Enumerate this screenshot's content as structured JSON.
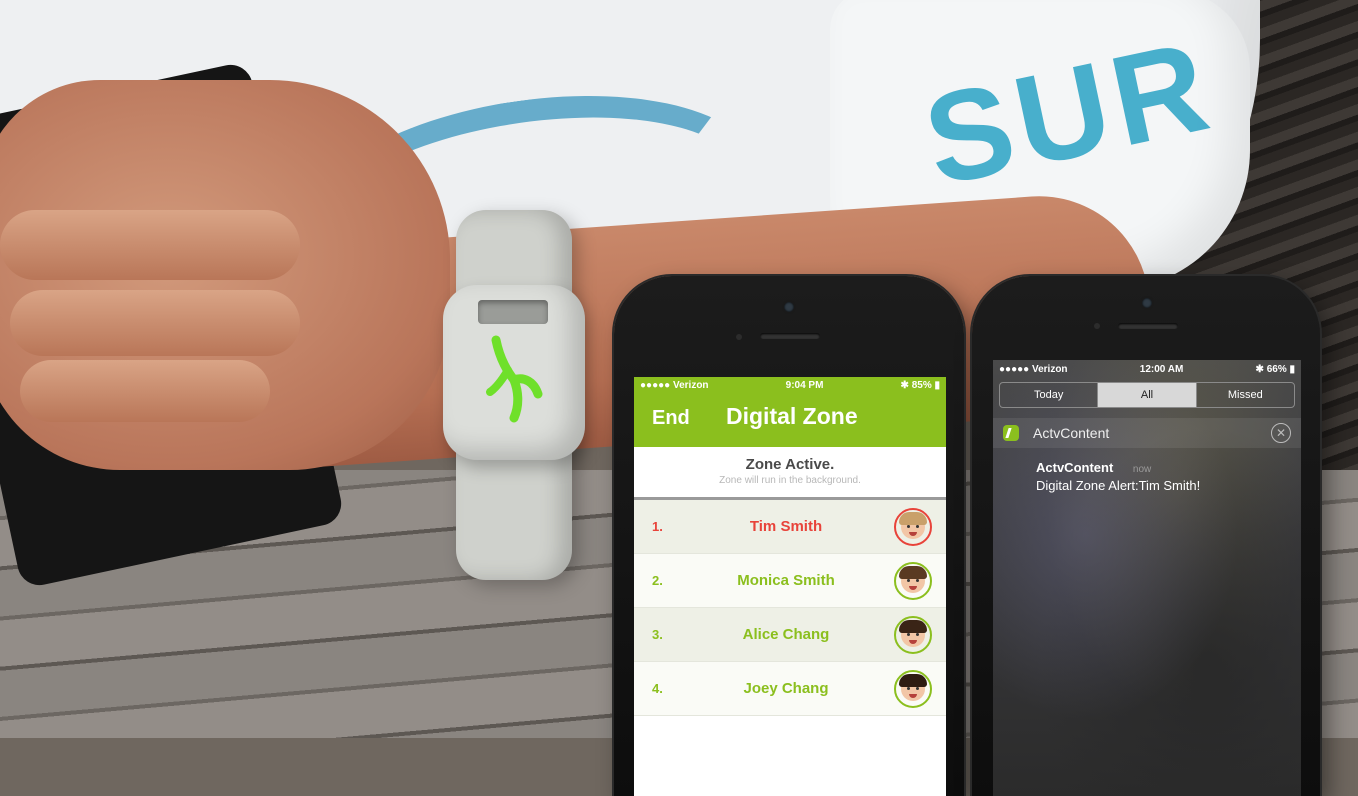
{
  "colors": {
    "brand_green": "#8bbf1e",
    "alert_red": "#e8433a",
    "sleeve_print": "#3aa9c9"
  },
  "photo": {
    "sleeve_text": "SUR"
  },
  "left_phone": {
    "status": {
      "carrier": "●●●●● Verizon",
      "time": "9:04 PM",
      "battery": "85%"
    },
    "nav": {
      "end_label": "End",
      "title": "Digital Zone"
    },
    "zone": {
      "title": "Zone Active.",
      "subtitle": "Zone will run in the background."
    },
    "kids": [
      {
        "num": "1.",
        "name": "Tim Smith",
        "state": "alert",
        "avatar": "boy-avatar"
      },
      {
        "num": "2.",
        "name": "Monica Smith",
        "state": "ok",
        "avatar": "girl-avatar"
      },
      {
        "num": "3.",
        "name": "Alice Chang",
        "state": "ok",
        "avatar": "girl-avatar"
      },
      {
        "num": "4.",
        "name": "Joey Chang",
        "state": "ok",
        "avatar": "boy-avatar"
      }
    ]
  },
  "right_phone": {
    "status": {
      "carrier": "●●●●● Verizon",
      "time": "12:00 AM",
      "battery": "66%"
    },
    "tabs": [
      "Today",
      "All",
      "Missed"
    ],
    "active_tab": "All",
    "notification": {
      "app_name": "ActvContent",
      "sender": "ActvContent",
      "time": "now",
      "message": "Digital Zone Alert:Tim Smith!"
    }
  }
}
